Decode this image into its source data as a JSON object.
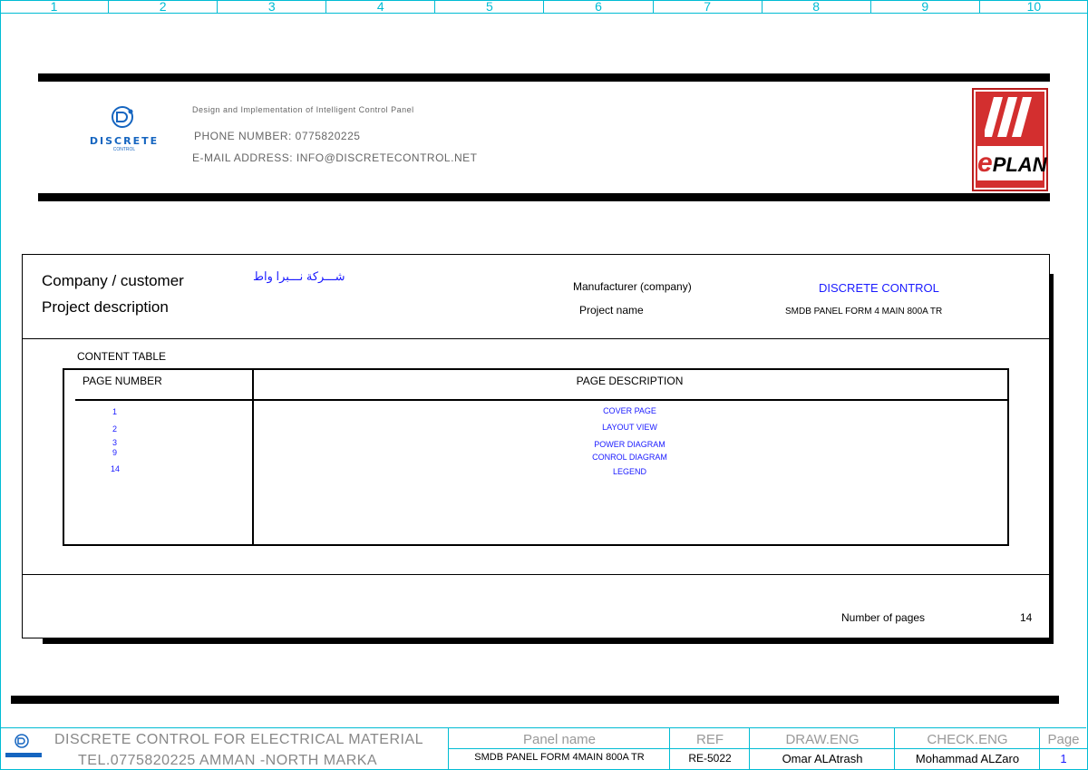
{
  "ruler": [
    "1",
    "2",
    "3",
    "4",
    "5",
    "6",
    "7",
    "8",
    "9",
    "10"
  ],
  "header": {
    "tagline": "Design and Implementation of Intelligent Control Panel",
    "phone": "PHONE NUMBER: 0775820225",
    "email": "E-MAIL ADDRESS: INFO@DISCRETECONTROL.NET",
    "logo_text": "DISCRETE",
    "logo_subtext": "CONTROL",
    "eplan_text": "PLAN",
    "eplan_e": "e"
  },
  "cover": {
    "company_label": "Company / customer",
    "company_value": "شـــركة نـــبرا واط",
    "project_desc_label": "Project description",
    "manufacturer_label": "Manufacturer (company)",
    "manufacturer_value": "DISCRETE CONTROL",
    "project_name_label": "Project name",
    "project_name_value": "SMDB PANEL FORM 4 MAIN 800A TR",
    "content_table_title": "CONTENT TABLE",
    "col_page_number": "PAGE NUMBER",
    "col_page_description": "PAGE DESCRIPTION",
    "rows": [
      {
        "page": "1",
        "desc": "COVER PAGE"
      },
      {
        "page": "2",
        "desc": "LAYOUT VIEW"
      },
      {
        "page": "3",
        "desc": "POWER DIAGRAM"
      },
      {
        "page": "9",
        "desc": "CONROL DIAGRAM"
      },
      {
        "page": "14",
        "desc": "LEGEND"
      }
    ],
    "num_pages_label": "Number of pages",
    "num_pages_value": "14"
  },
  "footer": {
    "company_line1": "DISCRETE CONTROL FOR ELECTRICAL MATERIAL",
    "company_line2": "TEL.0775820225 AMMAN -NORTH MARKA",
    "panel_name_label": "Panel name",
    "panel_name_value": "SMDB PANEL FORM 4MAIN 800A TR",
    "ref_label": "REF",
    "ref_value": "RE-5022",
    "draw_label": "DRAW.ENG",
    "draw_value": "Omar ALAtrash",
    "check_label": "CHECK.ENG",
    "check_value": "Mohammad ALZaro",
    "page_label": "Page",
    "page_value": "1"
  },
  "colors": {
    "accent_cyan": "#00bcd4",
    "link_blue": "#1a1aff",
    "eplan_red": "#d32f2f"
  }
}
